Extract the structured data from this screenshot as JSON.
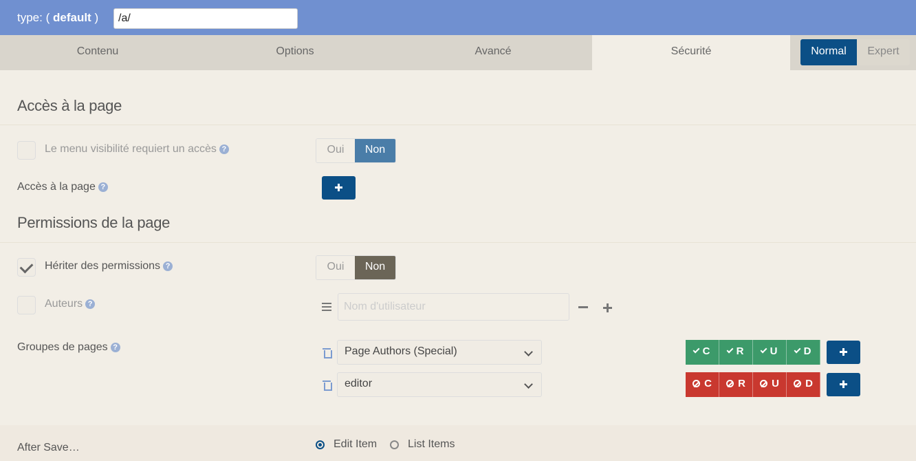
{
  "header": {
    "type_prefix": "type: (",
    "type_value": "default",
    "type_suffix": ")",
    "path_value": "/a/"
  },
  "tabs": [
    {
      "label": "Contenu",
      "active": false
    },
    {
      "label": "Options",
      "active": false
    },
    {
      "label": "Avancé",
      "active": false
    },
    {
      "label": "Sécurité",
      "active": true
    }
  ],
  "mode": {
    "normal_label": "Normal",
    "expert_label": "Expert",
    "selected": "Normal"
  },
  "access": {
    "title": "Accès à la page",
    "menu_visibility": {
      "label": "Le menu visibilité requiert un accès",
      "checked": false,
      "oui": "Oui",
      "non": "Non",
      "selected": "Non"
    },
    "page_access_label": "Accès à la page"
  },
  "permissions": {
    "title": "Permissions de la page",
    "inherit": {
      "label": "Hériter des permissions",
      "checked": true,
      "oui": "Oui",
      "non": "Non",
      "selected": "Non"
    },
    "authors": {
      "label": "Auteurs",
      "checked": false,
      "placeholder": "Nom d'utilisateur"
    },
    "groups_label": "Groupes de pages",
    "groups": [
      {
        "name": "Page Authors (Special)",
        "perms": [
          "C",
          "R",
          "U",
          "D"
        ],
        "state": "allow",
        "color": "#3c9a6a"
      },
      {
        "name": "editor",
        "perms": [
          "C",
          "R",
          "U",
          "D"
        ],
        "state": "deny",
        "color": "#c9382f"
      }
    ]
  },
  "after_save": {
    "label": "After Save…",
    "options": [
      {
        "label": "Edit Item",
        "selected": true
      },
      {
        "label": "List Items",
        "selected": false
      }
    ]
  },
  "colors": {
    "header": "#7090d0",
    "primary": "#0b4f86",
    "allow": "#3c9a6a",
    "deny": "#c9382f"
  }
}
